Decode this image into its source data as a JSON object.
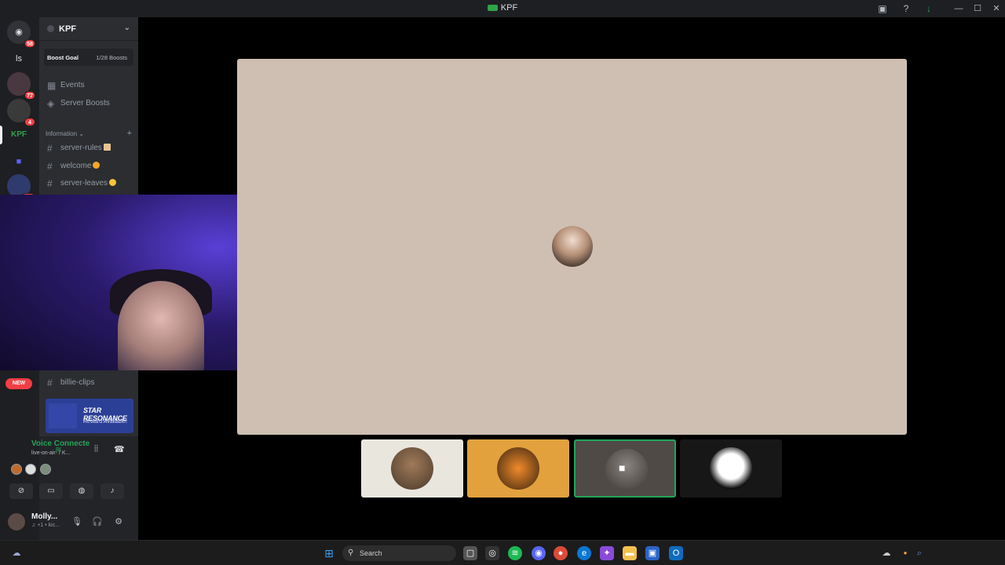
{
  "window": {
    "title": "KPF"
  },
  "guilds": [
    {
      "name": "discord-home",
      "badge": "58"
    },
    {
      "name": "ls-server",
      "label": "ls"
    },
    {
      "name": "guild-a",
      "badge": "77"
    },
    {
      "name": "guild-sx",
      "badge": "4"
    },
    {
      "name": "guild-kpf",
      "label": "KPF"
    },
    {
      "name": "guild-folder"
    },
    {
      "name": "guild-b",
      "badge": "167"
    }
  ],
  "new_badge": "NEW",
  "server": {
    "name": "KPF",
    "boost_goal_label": "Boost Goal",
    "boost_count": "1/28 Boosts",
    "events": "Events",
    "server_boosts": "Server Boosts",
    "category": "Information",
    "channels": [
      "server-rules",
      "welcome",
      "server-leaves",
      "billie-clips"
    ]
  },
  "promo": {
    "title": "STAR RESONANCE",
    "subtitle": "Reward Available!"
  },
  "voice": {
    "status": "Voice Connecte",
    "channel": "live-on-air- / K..."
  },
  "user": {
    "name": "Molly...",
    "status": "♫ +1 • kic..."
  },
  "taskbar": {
    "search_placeholder": "Search"
  },
  "colors": {
    "accent_green": "#23a55a",
    "stage_bg": "#cfbfb3",
    "tile_orange": "#e2a13d"
  }
}
